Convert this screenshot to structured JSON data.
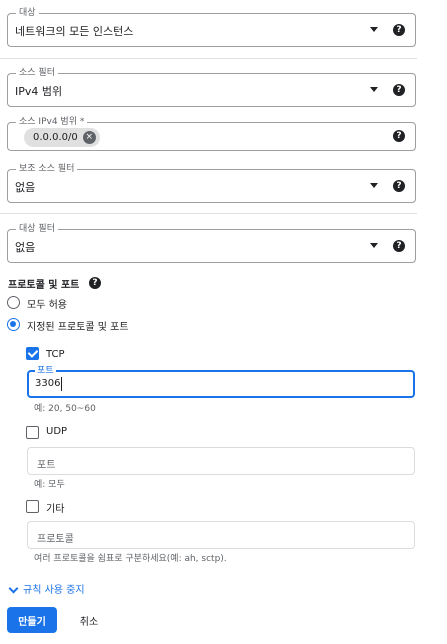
{
  "target": {
    "label": "대상",
    "value": "네트워크의 모든 인스턴스"
  },
  "source_filter": {
    "label": "소스 필터",
    "value": "IPv4 범위"
  },
  "source_ipv4": {
    "label": "소스 IPv4 범위 *",
    "chip": "0.0.0.0/0",
    "chip_remove": "×"
  },
  "secondary_source_filter": {
    "label": "보조 소스 필터",
    "value": "없음"
  },
  "destination_filter": {
    "label": "대상 필터",
    "value": "없음"
  },
  "help_glyph": "?",
  "protocols": {
    "title": "프로토콜 및 포트",
    "allow_all": "모두 허용",
    "specified": "지정된 프로토콜 및 포트",
    "selected_option": "specified",
    "tcp": {
      "label": "TCP",
      "checked": true,
      "ports_label": "포트",
      "ports_value": "3306",
      "hint": "예: 20, 50~60"
    },
    "udp": {
      "label": "UDP",
      "checked": false,
      "placeholder": "포트",
      "hint": "예: 모두"
    },
    "other": {
      "label": "기타",
      "checked": false,
      "placeholder": "프로토콜",
      "hint": "여러 프로토콜을 쉼표로 구분하세요(예: ah, sctp)."
    }
  },
  "toggle_link": "규칙 사용 중지",
  "actions": {
    "create": "만들기",
    "cancel": "취소"
  },
  "colors": {
    "accent": "#1a73e8",
    "text": "#202124",
    "muted": "#5f6368"
  },
  "icons": [
    "dropdown-arrow-icon",
    "help-icon",
    "chip-remove-icon",
    "chevron-down-icon",
    "check-icon"
  ]
}
